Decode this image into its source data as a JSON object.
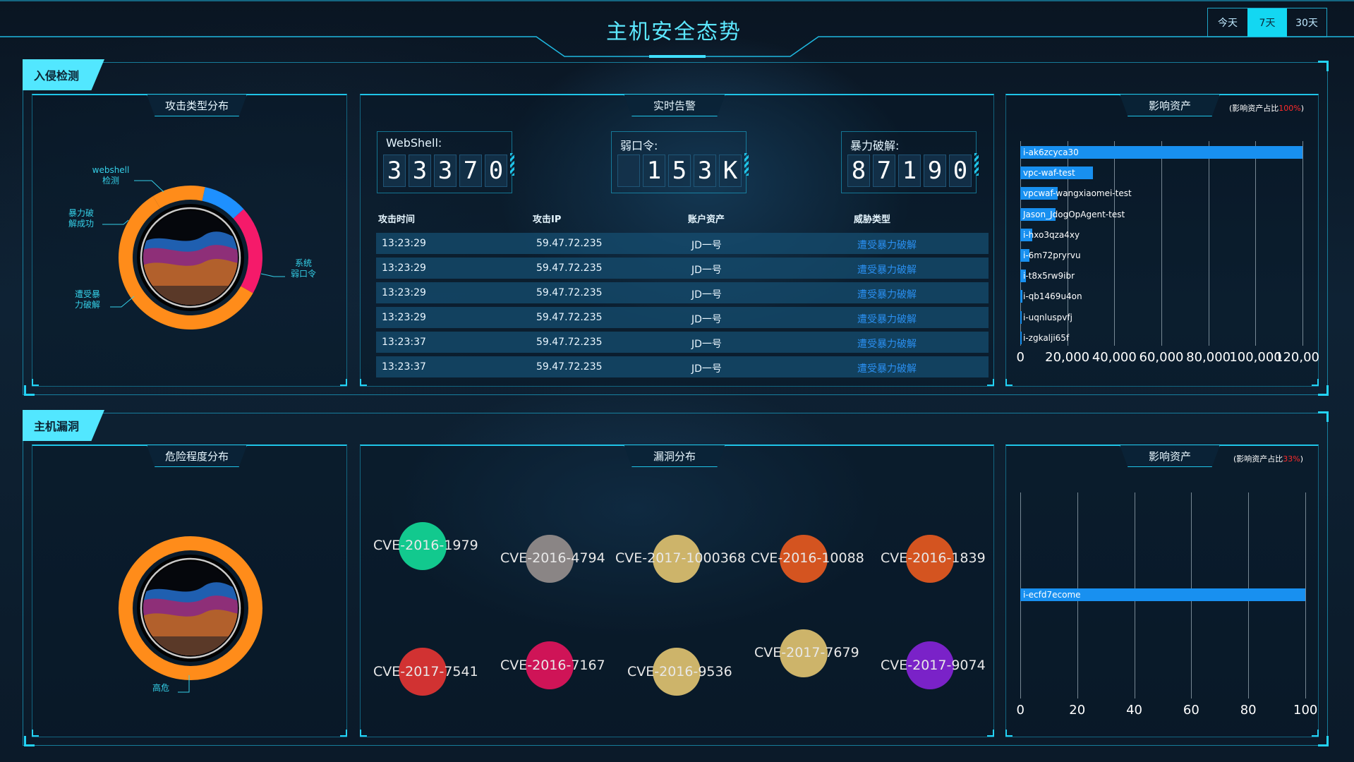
{
  "header": {
    "title": "主机安全态势",
    "ranges": [
      "今天",
      "7天",
      "30天"
    ],
    "active_range": "7天"
  },
  "intrusion": {
    "section_label": "入侵检测",
    "attack_types": {
      "title": "攻击类型分布",
      "labels": [
        "webshell\n检测",
        "暴力破\n解成功",
        "遭受暴\n力破解",
        "系统\n弱口令"
      ]
    },
    "alerts": {
      "title": "实时告警",
      "counters": [
        {
          "label": "WebShell:",
          "digits": [
            "3",
            "3",
            "3",
            "7",
            "0"
          ]
        },
        {
          "label": "弱口令:",
          "digits": [
            "",
            "1",
            "5",
            "3",
            "K"
          ]
        },
        {
          "label": "暴力破解:",
          "digits": [
            "8",
            "7",
            "1",
            "9",
            "0"
          ]
        }
      ],
      "columns": [
        "攻击时间",
        "攻击IP",
        "账户资产",
        "威胁类型"
      ],
      "rows": [
        {
          "time": "13:23:29",
          "ip": "59.47.72.235",
          "account": "JD一号",
          "threat": "遭受暴力破解"
        },
        {
          "time": "13:23:29",
          "ip": "59.47.72.235",
          "account": "JD一号",
          "threat": "遭受暴力破解"
        },
        {
          "time": "13:23:29",
          "ip": "59.47.72.235",
          "account": "JD一号",
          "threat": "遭受暴力破解"
        },
        {
          "time": "13:23:29",
          "ip": "59.47.72.235",
          "account": "JD一号",
          "threat": "遭受暴力破解"
        },
        {
          "time": "13:23:37",
          "ip": "59.47.72.235",
          "account": "JD一号",
          "threat": "遭受暴力破解"
        },
        {
          "time": "13:23:37",
          "ip": "59.47.72.235",
          "account": "JD一号",
          "threat": "遭受暴力破解"
        }
      ]
    },
    "assets": {
      "title": "影响资产",
      "ratio_prefix": "(影响资产占比",
      "ratio_value": "100%",
      "ratio_suffix": ")"
    }
  },
  "vuln": {
    "section_label": "主机漏洞",
    "severity": {
      "title": "危险程度分布",
      "label": "高危"
    },
    "distribution": {
      "title": "漏洞分布",
      "bubbles": [
        {
          "name": "CVE-2016-1979",
          "color": "#12c98e"
        },
        {
          "name": "CVE-2016-4794",
          "color": "#8a8585"
        },
        {
          "name": "CVE-2017-1000368",
          "color": "#cdb46a"
        },
        {
          "name": "CVE-2016-10088",
          "color": "#d45420"
        },
        {
          "name": "CVE-2016-1839",
          "color": "#d45420"
        },
        {
          "name": "CVE-2017-7541",
          "color": "#d13232"
        },
        {
          "name": "CVE-2016-7167",
          "color": "#cf1457"
        },
        {
          "name": "CVE-2016-9536",
          "color": "#cdb46a"
        },
        {
          "name": "CVE-2017-7679",
          "color": "#cdb46a"
        },
        {
          "name": "CVE-2017-9074",
          "color": "#7a22c8"
        }
      ]
    },
    "assets": {
      "title": "影响资产",
      "ratio_prefix": "(影响资产占比",
      "ratio_value": "33%",
      "ratio_suffix": ")"
    }
  },
  "chart_data": [
    {
      "type": "pie",
      "title": "攻击类型分布",
      "categories": [
        "webshell检测",
        "暴力破解成功",
        "遭受暴力破解",
        "系统弱口令"
      ],
      "values": [
        12,
        10,
        20,
        58
      ],
      "colors": [
        "#ff8c1a",
        "#1e90ff",
        "#f51a6a",
        "#ff8c1a"
      ]
    },
    {
      "type": "bar",
      "title": "影响资产",
      "orientation": "horizontal",
      "categories": [
        "i-ak6zcyca30",
        "vpc-waf-test",
        "vpcwaf-wangxiaomei-test",
        "Jason_JdogOpAgent-test",
        "i-hxo3qza4xy",
        "i-6m72pryrvu",
        "i-t8x5rw9ibr",
        "i-qb1469u4on",
        "i-uqnluspvfj",
        "i-zgkalji65f"
      ],
      "values": [
        120000,
        31000,
        16000,
        15000,
        5000,
        4000,
        2500,
        1000,
        500,
        300
      ],
      "xlim": [
        0,
        120000
      ],
      "xticks": [
        "0",
        "20,000",
        "40,000",
        "60,000",
        "80,000",
        "100,000",
        "120,00"
      ]
    },
    {
      "type": "pie",
      "title": "危险程度分布",
      "categories": [
        "高危"
      ],
      "values": [
        100
      ],
      "colors": [
        "#ff8c1a"
      ]
    },
    {
      "type": "bar",
      "title": "影响资产",
      "orientation": "horizontal",
      "categories": [
        "i-ecfd7ecome"
      ],
      "values": [
        100
      ],
      "xlim": [
        0,
        100
      ],
      "xticks": [
        "0",
        "20",
        "40",
        "60",
        "80",
        "100"
      ]
    }
  ]
}
